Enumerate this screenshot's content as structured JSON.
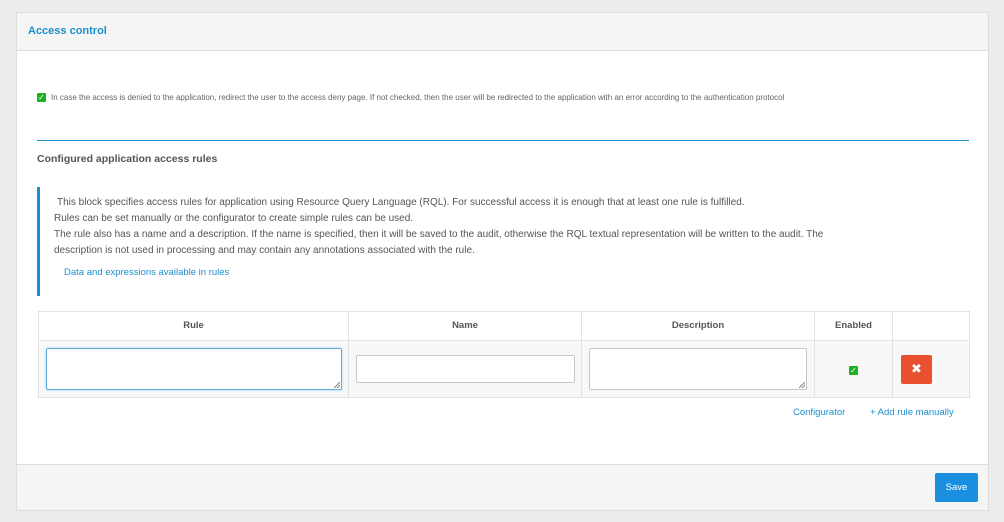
{
  "panel": {
    "title": "Access control"
  },
  "redirect": {
    "checked": true,
    "text": "In case the access is denied to the application, redirect the user to the access deny page. If not checked, then the user will be redirected to the application with an error according to the authentication protocol"
  },
  "rules_section": {
    "heading": "Configured application access rules",
    "info_lines": [
      "This block specifies access rules for application using Resource Query Language (RQL). For successful access it is enough that at least one rule is fulfilled.",
      "Rules can be set manually or the configurator to create simple rules can be used.",
      "The rule also has a name and a description. If the name is specified, then it will be saved to the audit, otherwise the RQL textual representation will be written to the audit. The",
      "description is not used in processing and may contain any annotations associated with the rule."
    ],
    "info_link": "Data and expressions available in rules"
  },
  "table": {
    "columns": [
      "Rule",
      "Name",
      "Description",
      "Enabled",
      ""
    ],
    "rows": [
      {
        "rule": "",
        "name": "",
        "description": "",
        "enabled": true
      }
    ],
    "delete_icon": "close-icon"
  },
  "actions": {
    "configurator": "Configurator",
    "add_rule": "+ Add rule manually"
  },
  "footer": {
    "save_label": "Save"
  },
  "colors": {
    "accent": "#1a8fcf",
    "check": "#1eb023",
    "danger": "#e8512f",
    "primary_button": "#1a8fe0"
  }
}
